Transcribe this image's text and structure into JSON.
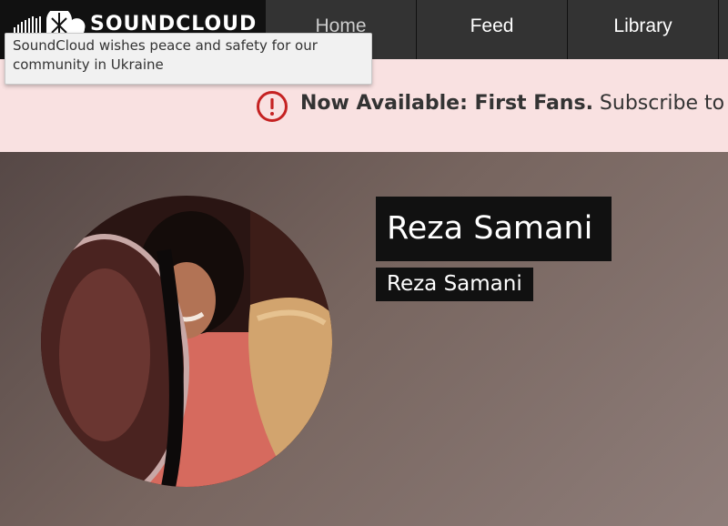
{
  "header": {
    "logo_text": "SOUNDCLOUD",
    "nav": [
      "Home",
      "Feed",
      "Library"
    ]
  },
  "tooltip": {
    "text": "SoundCloud wishes peace and safety for our community in Ukraine"
  },
  "banner": {
    "bold": "Now Available: First Fans.",
    "text": " Subscribe to Ne",
    "icon": "alert-circle-icon",
    "icon_color": "#c52222"
  },
  "profile": {
    "display_name": "Reza Samani",
    "username": "Reza Samani"
  }
}
